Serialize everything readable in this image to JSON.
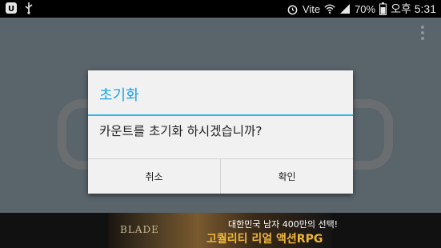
{
  "status_bar": {
    "carrier_label": "Vite",
    "battery_percent": "70%",
    "clock": "오후 5:31",
    "icons": [
      "notification-app-icon",
      "usb-icon",
      "alarm-icon",
      "wifi-icon",
      "signal-icon",
      "battery-icon"
    ]
  },
  "app": {
    "menu_icon": "overflow-menu-icon"
  },
  "dialog": {
    "title": "초기화",
    "message": "카운트를 초기화 하시겠습니까?",
    "cancel_label": "취소",
    "confirm_label": "확인",
    "accent_color": "#33b5e5"
  },
  "ad": {
    "logo": "BLADE",
    "line1": "대한민국 남자 400만의 선택!",
    "line2": "고퀄리티 리얼 액션RPG"
  }
}
